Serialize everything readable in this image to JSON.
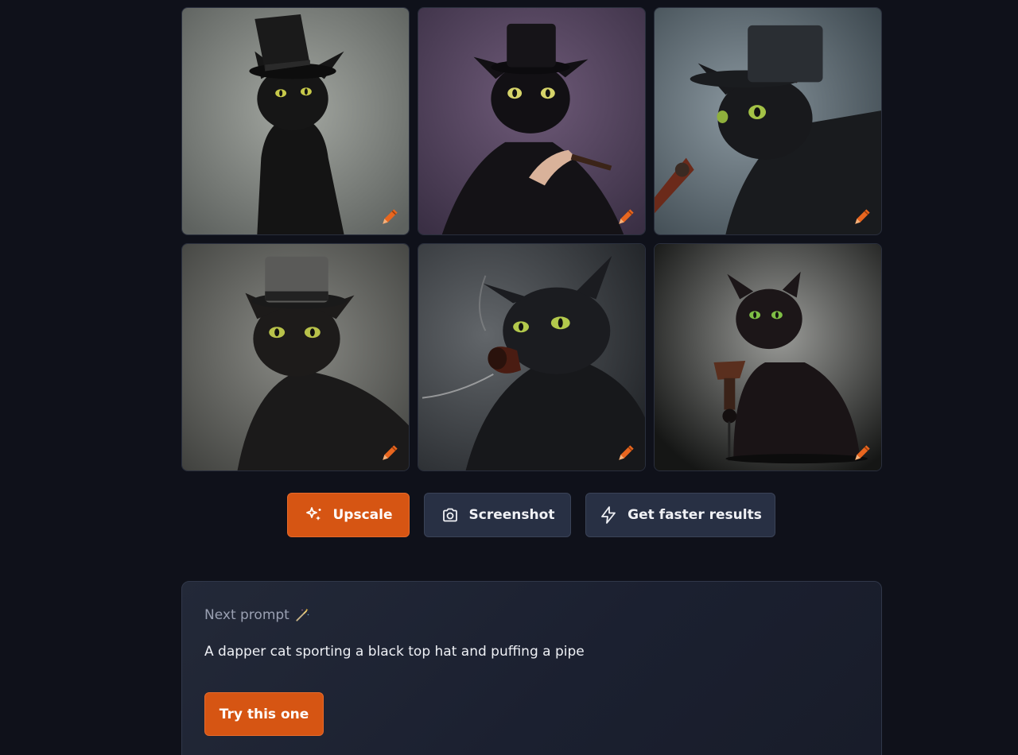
{
  "grid": {
    "images": [
      {
        "name": "cat-image-1"
      },
      {
        "name": "cat-image-2"
      },
      {
        "name": "cat-image-3"
      },
      {
        "name": "cat-image-4"
      },
      {
        "name": "cat-image-5"
      },
      {
        "name": "cat-image-6"
      }
    ],
    "edit_icon": "pencil-icon"
  },
  "actions": {
    "upscale_label": "Upscale",
    "upscale_icon": "sparkles-icon",
    "screenshot_label": "Screenshot",
    "screenshot_icon": "camera-icon",
    "faster_label": "Get faster results",
    "faster_icon": "lightning-icon"
  },
  "next_prompt": {
    "label": "Next prompt",
    "label_icon": "magic-wand-icon",
    "prompt_text": "A dapper cat sporting a black top hat and puffing a pipe",
    "try_label": "Try this one"
  },
  "colors": {
    "page_bg": "#0f111a",
    "accent": "#d65513",
    "secondary_button": "#283044",
    "card_bg": "#1e2333"
  }
}
